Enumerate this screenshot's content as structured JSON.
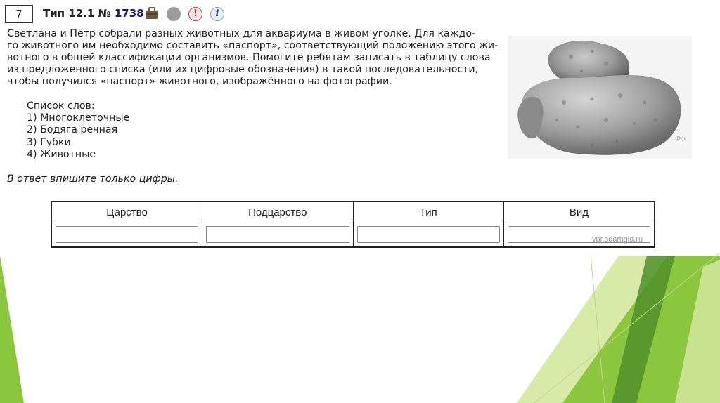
{
  "task": {
    "number": "7",
    "title_prefix": "Тип 12.1 №",
    "id": "1738",
    "text_lines": [
      "Светлана и Пётр собрали разных животных для аквариума в живом уголке. Для каждо-",
      "го животного им необходимо составить «паспорт», соответствующий положению этого жи-",
      "вотного в общей классификации организмов. Помогите ребятам записать в таблицу слова",
      "из предложенного списка (или их цифровые обозначения) в такой последовательности,",
      "чтобы получился «паспорт» животного, изображённого на фотографии."
    ],
    "list_title": "Список слов:",
    "list_items": [
      "1) Многоклеточные",
      "2) Бодяга речная",
      "3) Губки",
      "4) Животные"
    ],
    "answer_note": "В ответ впишите только цифры."
  },
  "photo": {
    "watermark": "РФ"
  },
  "answer_table": {
    "headers": [
      "Царство",
      "Подцарство",
      "Тип",
      "Вид"
    ],
    "inputs": [
      "",
      "",
      "",
      ""
    ]
  },
  "site_watermark": "vpr.sdamgia.ru",
  "theme_colors": {
    "green_light": "#c9e28f",
    "green_mid": "#8cc63e",
    "green_dark": "#4f8f2a"
  }
}
